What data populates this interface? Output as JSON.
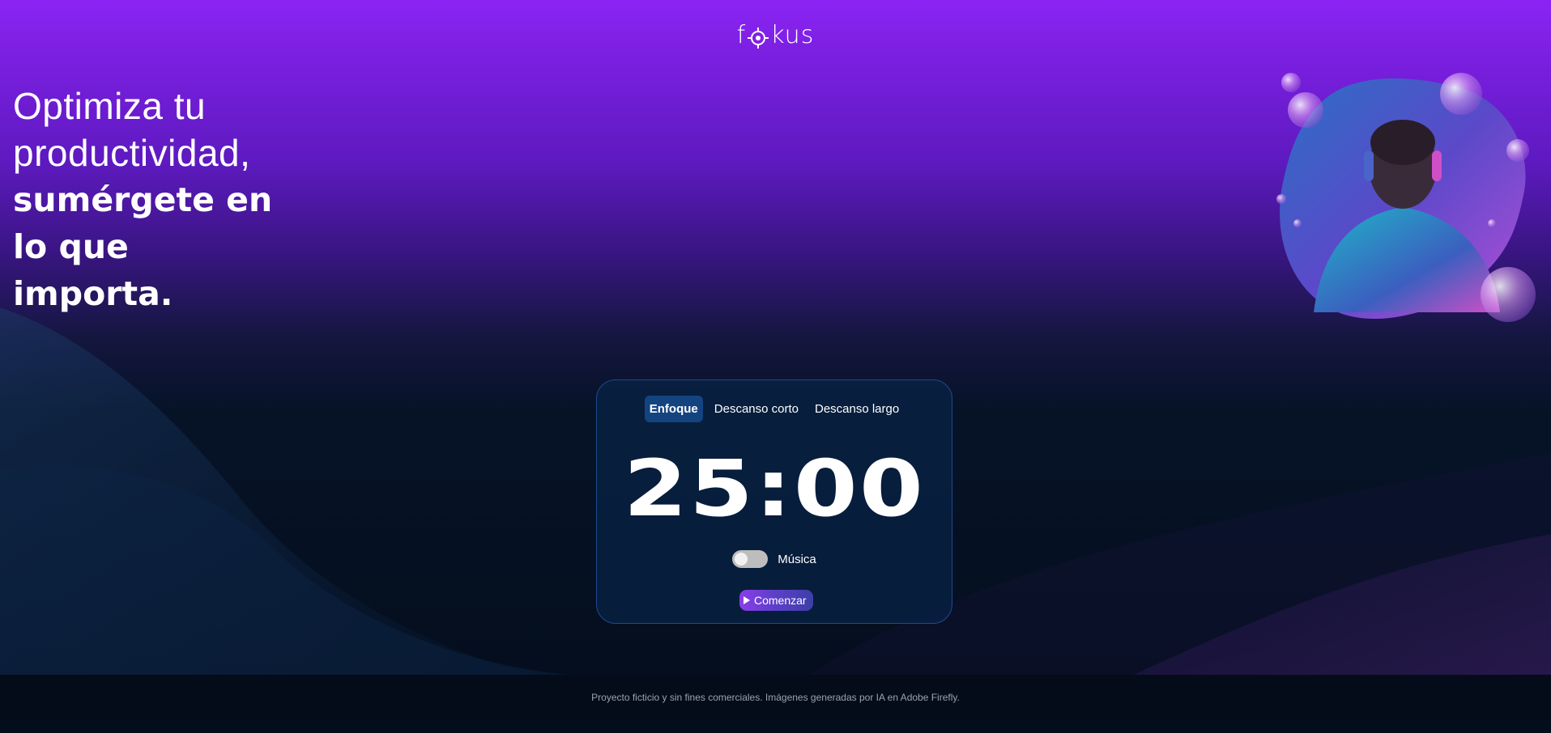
{
  "brand": {
    "logo_text_before": "f",
    "logo_text_after": "kus"
  },
  "hero": {
    "line1": "Optimiza tu",
    "line2": "productividad,",
    "line3": "sumérgete en",
    "line4": "lo que",
    "line5": "importa."
  },
  "timer_card": {
    "tabs": [
      {
        "label": "Enfoque",
        "active": true
      },
      {
        "label": "Descanso corto",
        "active": false
      },
      {
        "label": "Descanso largo",
        "active": false
      }
    ],
    "time": "25:00",
    "music": {
      "label": "Música",
      "enabled": false
    },
    "start_label": "Comenzar"
  },
  "footer": {
    "text": "Proyecto ficticio y sin fines comerciales. Imágenes generadas por IA en Adobe Firefly."
  },
  "colors": {
    "accent": "#8b24f3",
    "card_border": "#1d4a8f",
    "active_tab": "#144480"
  }
}
